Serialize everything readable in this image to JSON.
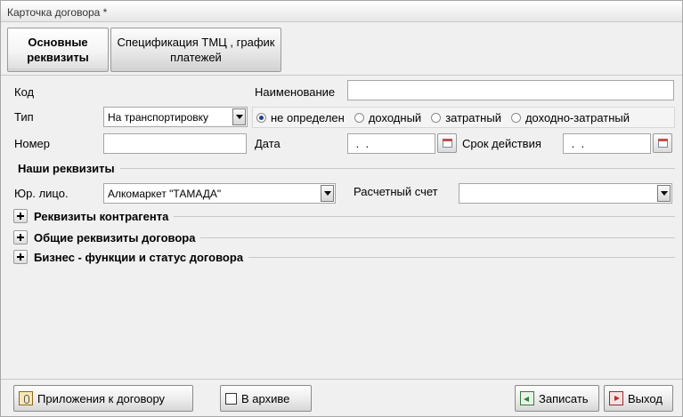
{
  "window": {
    "title": "Карточка договора *"
  },
  "tabs": [
    {
      "label": "Основные реквизиты",
      "active": true
    },
    {
      "label": "Спецификация ТМЦ , график платежей",
      "active": false
    }
  ],
  "form": {
    "code_label": "Код",
    "code_value": "",
    "name_label": "Наименование",
    "name_value": "",
    "type_label": "Тип",
    "type_value": "На транспортировку",
    "radio_options": [
      "не определен",
      "доходный",
      "затратный",
      "доходно-затратный"
    ],
    "radio_selected": "не определен",
    "number_label": "Номер",
    "number_value": "",
    "date_label": "Дата",
    "date_value": " .  .",
    "validity_label": "Срок действия",
    "validity_value": " .  ."
  },
  "our_details": {
    "title": "Наши реквизиты",
    "legal_entity_label": "Юр. лицо.",
    "legal_entity_value": "Алкомаркет \"ТАМАДА\"",
    "account_label": "Расчетный счет",
    "account_value": ""
  },
  "sections": [
    {
      "title": "Реквизиты контрагента"
    },
    {
      "title": "Общие реквизиты договора"
    },
    {
      "title": "Бизнес - функции и статус договора"
    }
  ],
  "footer": {
    "attachments_label": "Приложения к договору",
    "archive_label": "В архиве",
    "archive_checked": false,
    "save_label": "Записать",
    "exit_label": "Выход"
  },
  "icons": {
    "attachments": "attachment-icon",
    "archive": "checkbox-icon",
    "save": "save-icon",
    "exit": "exit-icon",
    "calendar": "calendar-icon",
    "dropdown": "chevron-down-icon",
    "expand": "plus-icon"
  }
}
